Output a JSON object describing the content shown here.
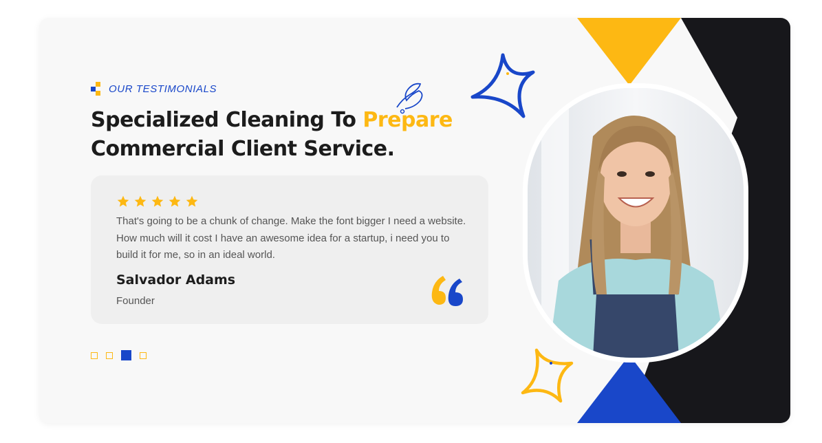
{
  "section": {
    "eyebrow": "OUR TESTIMONIALS",
    "heading_part1": "Specialized Cleaning To ",
    "heading_highlight": "Prepare",
    "heading_part2": "Commercial Client Service."
  },
  "testimonial": {
    "rating": 5,
    "text": "That's going to be a chunk of change. Make the font bigger I need a website. How much will it cost I have an awesome idea for a startup, i need you to build it for me, so in an ideal world.",
    "name": "Salvador Adams",
    "role": "Founder"
  },
  "slider": {
    "count": 4,
    "active_index": 2
  },
  "colors": {
    "accent_blue": "#1947c9",
    "accent_yellow": "#fdb813",
    "dark": "#17171b",
    "card_bg": "#f8f8f8",
    "review_bg": "#efefef"
  },
  "icons": [
    "brand-squares-icon",
    "star-icon",
    "quote-icon",
    "sparkle-icon",
    "squiggle-icon"
  ]
}
